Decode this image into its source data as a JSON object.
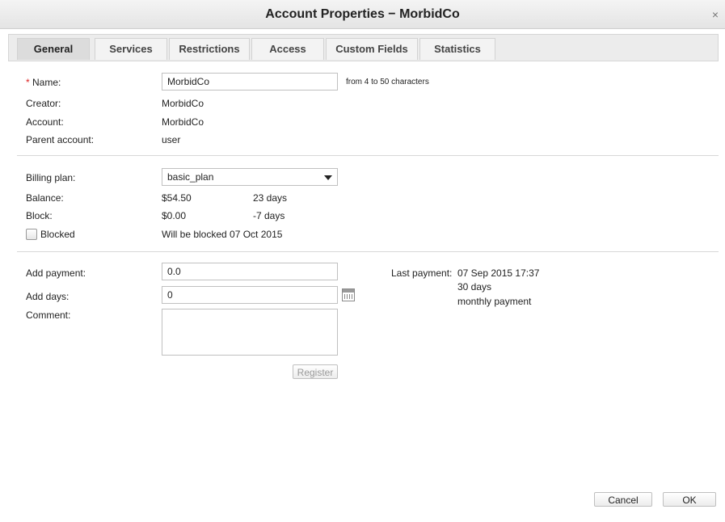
{
  "window": {
    "title": "Account Properties − MorbidCo",
    "close_glyph": "×"
  },
  "tabs": [
    {
      "label": "General"
    },
    {
      "label": "Services"
    },
    {
      "label": "Restrictions"
    },
    {
      "label": "Access"
    },
    {
      "label": "Custom Fields"
    },
    {
      "label": "Statistics"
    }
  ],
  "general": {
    "required_mark": "*",
    "name_label": "Name:",
    "name_value": "MorbidCo",
    "name_hint": "from 4 to 50 characters",
    "creator_label": "Creator:",
    "creator_value": "MorbidCo",
    "account_label": "Account:",
    "account_value": "MorbidCo",
    "parent_label": "Parent account:",
    "parent_value": "user"
  },
  "billing": {
    "plan_label": "Billing plan:",
    "plan_value": "basic_plan",
    "balance_label": "Balance:",
    "balance_value": "$54.50",
    "balance_days": "23 days",
    "block_label": "Block:",
    "block_value": "$0.00",
    "block_days": "-7 days",
    "blocked_label": "Blocked",
    "blocked_checked": false,
    "blocked_note": "Will be blocked 07 Oct 2015"
  },
  "payment": {
    "add_payment_label": "Add payment:",
    "add_payment_value": "0.0",
    "add_days_label": "Add days:",
    "add_days_value": "0",
    "comment_label": "Comment:",
    "comment_value": "",
    "register_label": "Register",
    "last_payment_label": "Last payment:",
    "last_payment_date": "07 Sep 2015 17:37",
    "last_payment_days": "30 days",
    "last_payment_type": "monthly payment"
  },
  "footer": {
    "cancel_label": "Cancel",
    "ok_label": "OK"
  }
}
